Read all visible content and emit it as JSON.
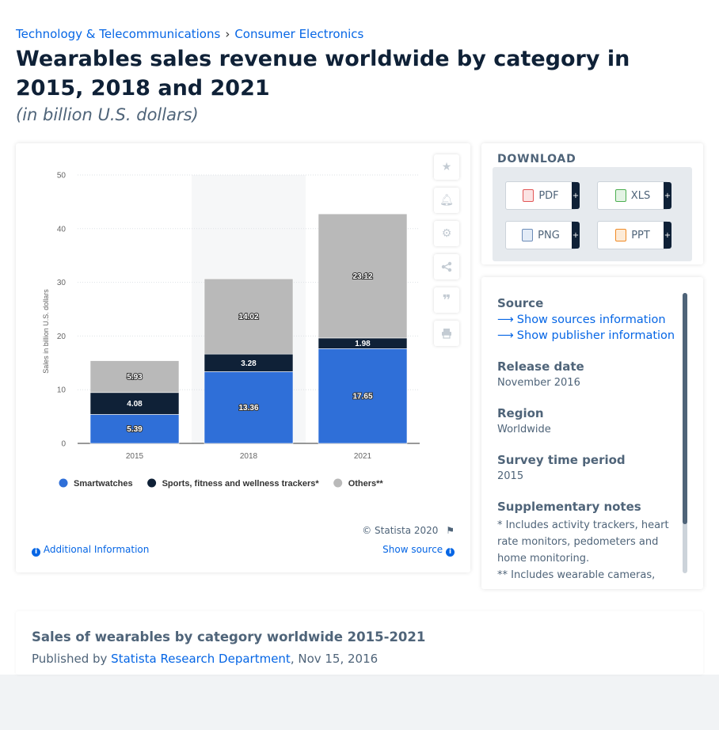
{
  "breadcrumb": {
    "items": [
      "Technology & Telecommunications",
      "Consumer Electronics"
    ],
    "separator": "›"
  },
  "title": "Wearables sales revenue worldwide by category in 2015, 2018 and 2021",
  "subtitle": "(in billion U.S. dollars)",
  "toolbar": {
    "icons": [
      "star-icon",
      "bell-icon",
      "gear-icon",
      "share-icon",
      "quote-icon",
      "print-icon"
    ]
  },
  "chart_data": {
    "type": "bar",
    "stacked": true,
    "categories": [
      "2015",
      "2018",
      "2021"
    ],
    "series": [
      {
        "name": "Smartwatches",
        "values": [
          5.39,
          13.36,
          17.65
        ],
        "color": "#2f6fd8"
      },
      {
        "name": "Sports, fitness and wellness trackers*",
        "values": [
          4.08,
          3.28,
          1.98
        ],
        "color": "#0f2137"
      },
      {
        "name": "Others**",
        "values": [
          5.93,
          14.02,
          23.12
        ],
        "color": "#b9b9b9"
      }
    ],
    "ylabel": "Sales in billion U.S. dollars",
    "ylim": [
      0,
      50
    ],
    "yticks": [
      0,
      10,
      20,
      30,
      40,
      50
    ],
    "grid": true,
    "highlighted_category": "2018",
    "legend_position": "bottom-left"
  },
  "footer": {
    "copyright": "© Statista 2020",
    "additional_info": "Additional Information",
    "show_source": "Show source"
  },
  "download": {
    "title": "DOWNLOAD",
    "buttons": [
      {
        "label": "PDF",
        "color": "#e25656"
      },
      {
        "label": "XLS",
        "color": "#4caf50"
      },
      {
        "label": "PNG",
        "color": "#6c8cb8"
      },
      {
        "label": "PPT",
        "color": "#f08a24"
      }
    ],
    "plus": "+"
  },
  "info": {
    "source_heading": "Source",
    "show_sources": "Show sources information",
    "show_publisher": "Show publisher information",
    "release_heading": "Release date",
    "release_value": "November 2016",
    "region_heading": "Region",
    "region_value": "Worldwide",
    "survey_heading": "Survey time period",
    "survey_value": "2015",
    "notes_heading": "Supplementary notes",
    "note1": "* Includes activity trackers, heart rate monitors, pedometers and home monitoring.",
    "note2": "** Includes wearable cameras,"
  },
  "publication": {
    "title": "Sales of wearables by category worldwide 2015-2021",
    "published_by": "Published by",
    "publisher": "Statista Research Department",
    "date": ", Nov 15, 2016"
  }
}
